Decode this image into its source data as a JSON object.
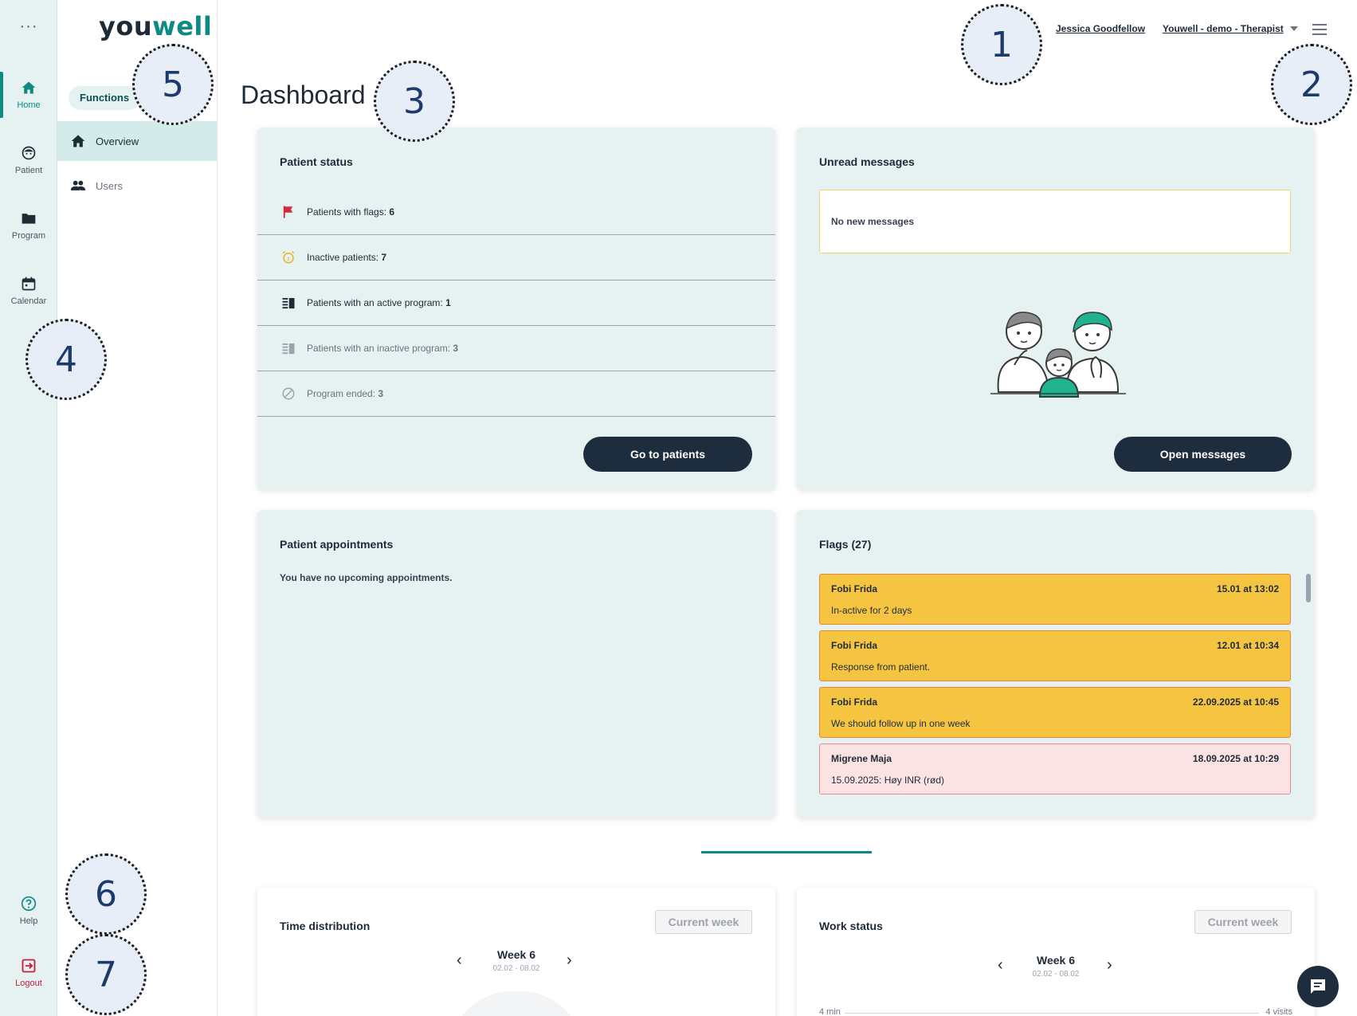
{
  "app": {
    "logo": "youwell",
    "logo_main": "you",
    "logo_accent": "well"
  },
  "rail": {
    "more": "···",
    "items": [
      {
        "label": "Home",
        "icon": "home-icon"
      },
      {
        "label": "Patient",
        "icon": "patient-icon"
      },
      {
        "label": "Program",
        "icon": "folder-icon"
      },
      {
        "label": "Calendar",
        "icon": "calendar-icon"
      }
    ],
    "help": "Help",
    "logout": "Logout"
  },
  "functions": {
    "tab": "Functions",
    "items": [
      {
        "label": "Overview",
        "icon": "home-icon"
      },
      {
        "label": "Users",
        "icon": "users-icon"
      }
    ]
  },
  "header": {
    "user": "Jessica Goodfellow",
    "org": "Youwell - demo - Therapist"
  },
  "page_title": "Dashboard",
  "patient_status": {
    "title": "Patient status",
    "rows": [
      {
        "label": "Patients with flags: ",
        "value": "6",
        "icon": "flag-icon"
      },
      {
        "label": "Inactive patients: ",
        "value": "7",
        "icon": "alarm-icon"
      },
      {
        "label": "Patients with an active program: ",
        "value": "1",
        "icon": "program-icon"
      },
      {
        "label": "Patients with an inactive program: ",
        "value": "3",
        "icon": "program-inactive-icon"
      },
      {
        "label": "Program ended: ",
        "value": "3",
        "icon": "block-icon"
      }
    ],
    "button": "Go to patients"
  },
  "unread_messages": {
    "title": "Unread messages",
    "empty": "No new messages",
    "button": "Open messages"
  },
  "appointments": {
    "title": "Patient appointments",
    "empty": "You have no upcoming appointments."
  },
  "flags": {
    "title": "Flags (27)",
    "items": [
      {
        "name": "Fobi Frida",
        "date": "15.01 at 13:02",
        "text": "In-active for 2 days",
        "color": "yellow"
      },
      {
        "name": "Fobi Frida",
        "date": "12.01 at 10:34",
        "text": "Response from patient.",
        "color": "yellow"
      },
      {
        "name": "Fobi Frida",
        "date": "22.09.2025 at 10:45",
        "text": "We should follow up in one week",
        "color": "yellow"
      },
      {
        "name": "Migrene Maja",
        "date": "18.09.2025 at 10:29",
        "text": "15.09.2025: Høy INR (rød)",
        "color": "pink"
      }
    ]
  },
  "time_distribution": {
    "title": "Time distribution",
    "button": "Current week",
    "week": "Week 6",
    "dates": "02.02 - 08.02"
  },
  "work_status": {
    "title": "Work status",
    "button": "Current week",
    "week": "Week 6",
    "dates": "02.02 - 08.02",
    "left_label": "4 min",
    "right_label": "4 visits"
  },
  "callouts": [
    "1",
    "2",
    "3",
    "4",
    "5",
    "6",
    "7"
  ],
  "colors": {
    "accent": "#0d8a84",
    "dark_button": "#1e2d3d",
    "card_bg": "#e6f2f1",
    "flag_yellow": "#f5c542",
    "flag_pink": "#fbe3e3"
  }
}
